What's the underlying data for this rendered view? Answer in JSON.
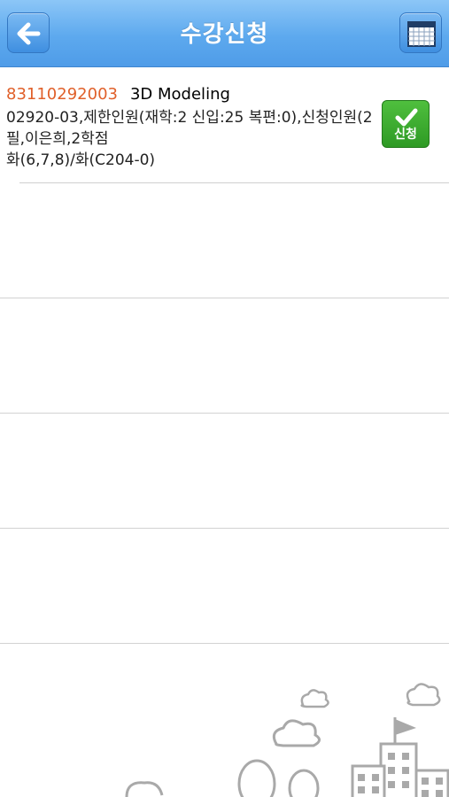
{
  "header": {
    "title": "수강신청",
    "back_icon": "arrow-left-icon",
    "calendar_icon": "calendar-icon"
  },
  "courses": [
    {
      "code": "83110292003",
      "name": "3D Modeling",
      "detail": "02920-03,제한인원(재학:2 신입:25 복편:0),신청인원(2",
      "detail2": "필,이은희,2학점",
      "schedule": "화(6,7,8)/화(C204-0)",
      "apply_label": "신청"
    }
  ],
  "colors": {
    "nav": "#5da9ee",
    "code": "#e0602a",
    "apply": "#2e9a24"
  }
}
